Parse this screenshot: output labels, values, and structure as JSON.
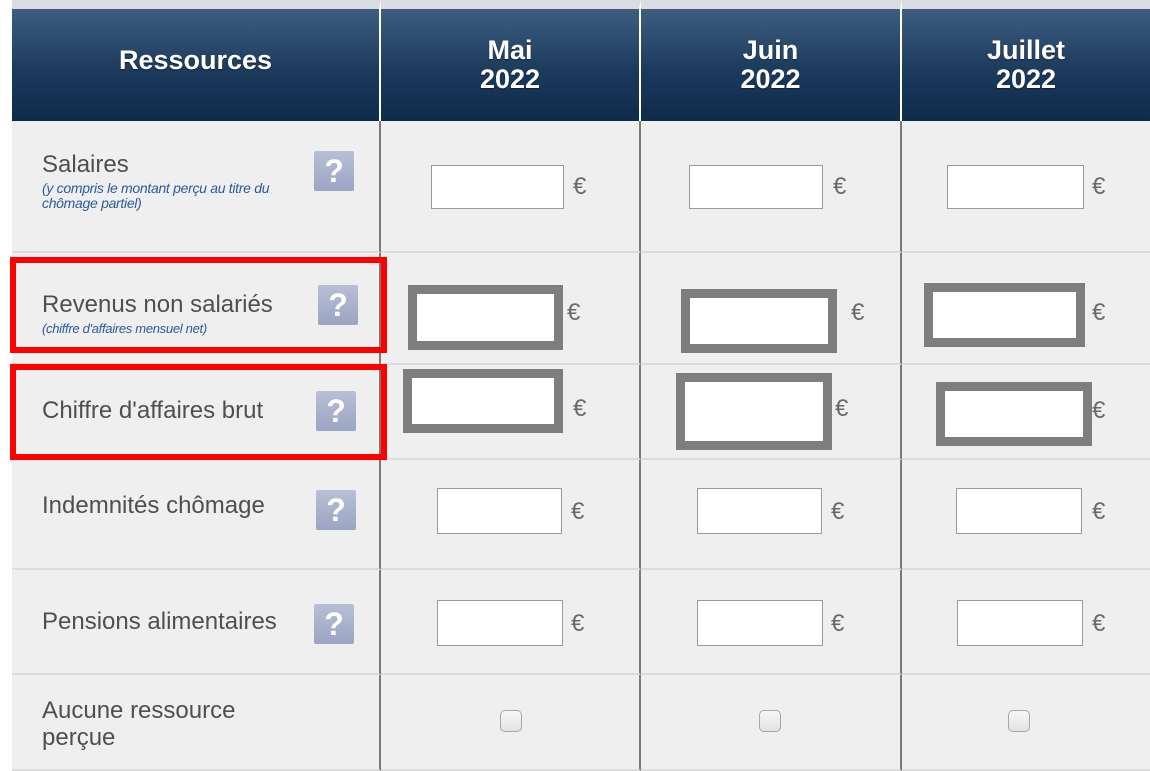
{
  "header": {
    "ressources": "Ressources",
    "months": [
      {
        "month": "Mai",
        "year": "2022"
      },
      {
        "month": "Juin",
        "year": "2022"
      },
      {
        "month": "Juillet",
        "year": "2022"
      }
    ]
  },
  "rows": [
    {
      "label": "Salaires",
      "sub": "(y compris le montant perçu au titre du chômage partiel)"
    },
    {
      "label": "Revenus non salariés",
      "sub": "(chiffre d'affaires mensuel net)"
    },
    {
      "label": "Chiffre d'affaires brut"
    },
    {
      "label": "Indemnités chômage"
    },
    {
      "label": "Pensions alimentaires"
    },
    {
      "label": "Aucune ressource perçue"
    }
  ],
  "help_glyph": "?",
  "currency": "€",
  "inputs": {
    "value": ""
  },
  "colors": {
    "header": "#1c3a5c",
    "highlight": "#ff0000",
    "cell_bg": "#efefef"
  },
  "icons": {
    "help": "question-mark-icon",
    "checkbox": "checkbox"
  }
}
